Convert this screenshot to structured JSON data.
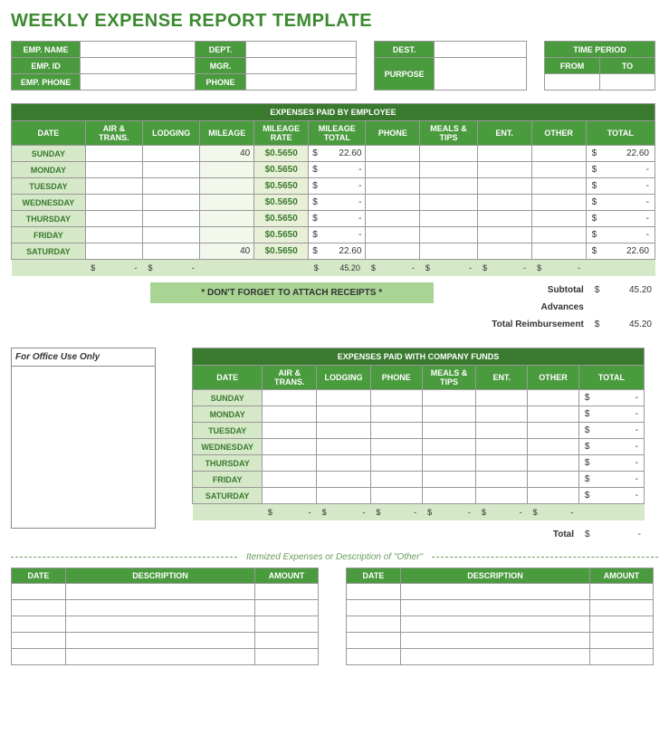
{
  "title": "WEEKLY EXPENSE REPORT TEMPLATE",
  "header": {
    "empName": "EMP. NAME",
    "empId": "EMP. ID",
    "empPhone": "EMP. PHONE",
    "dept": "DEPT.",
    "mgr": "MGR.",
    "phone": "PHONE",
    "dest": "DEST.",
    "purpose": "PURPOSE",
    "timePeriod": "TIME PERIOD",
    "from": "FROM",
    "to": "TO"
  },
  "emp": {
    "banner": "EXPENSES PAID BY EMPLOYEE",
    "cols": [
      "DATE",
      "AIR & TRANS.",
      "LODGING",
      "MILEAGE",
      "MILEAGE RATE",
      "MILEAGE TOTAL",
      "PHONE",
      "MEALS & TIPS",
      "ENT.",
      "OTHER",
      "TOTAL"
    ],
    "days": [
      "SUNDAY",
      "MONDAY",
      "TUESDAY",
      "WEDNESDAY",
      "THURSDAY",
      "FRIDAY",
      "SATURDAY"
    ],
    "mileage": [
      "40",
      "",
      "",
      "",
      "",
      "",
      "40"
    ],
    "rate": [
      "$0.5650",
      "$0.5650",
      "$0.5650",
      "$0.5650",
      "$0.5650",
      "$0.5650",
      "$0.5650"
    ],
    "mileageTotal": [
      "22.60",
      "-",
      "-",
      "-",
      "-",
      "-",
      "22.60"
    ],
    "rowTotal": [
      "22.60",
      "-",
      "-",
      "-",
      "-",
      "-",
      "22.60"
    ],
    "colTotals": {
      "air": "-",
      "lodging": "-",
      "mileageTotal": "45.20",
      "phone": "-",
      "meals": "-",
      "ent": "-",
      "other": "-"
    },
    "reminder": "* DON'T FORGET TO ATTACH RECEIPTS *",
    "subtotalLabel": "Subtotal",
    "subtotal": "45.20",
    "advancesLabel": "Advances",
    "reimbLabel": "Total Reimbursement",
    "reimb": "45.20"
  },
  "officeUse": "For Office Use Only",
  "comp": {
    "banner": "EXPENSES PAID WITH COMPANY FUNDS",
    "cols": [
      "DATE",
      "AIR & TRANS.",
      "LODGING",
      "PHONE",
      "MEALS & TIPS",
      "ENT.",
      "OTHER",
      "TOTAL"
    ],
    "days": [
      "SUNDAY",
      "MONDAY",
      "TUESDAY",
      "WEDNESDAY",
      "THURSDAY",
      "FRIDAY",
      "SATURDAY"
    ],
    "rowTotal": [
      "-",
      "-",
      "-",
      "-",
      "-",
      "-",
      "-"
    ],
    "colTotals": [
      "-",
      "-",
      "-",
      "-",
      "-",
      "-"
    ],
    "totalLabel": "Total",
    "total": "-"
  },
  "itemized": {
    "divider": "Itemized Expenses or Description of \"Other\"",
    "cols": [
      "DATE",
      "DESCRIPTION",
      "AMOUNT"
    ]
  },
  "sym": {
    "dollar": "$"
  }
}
